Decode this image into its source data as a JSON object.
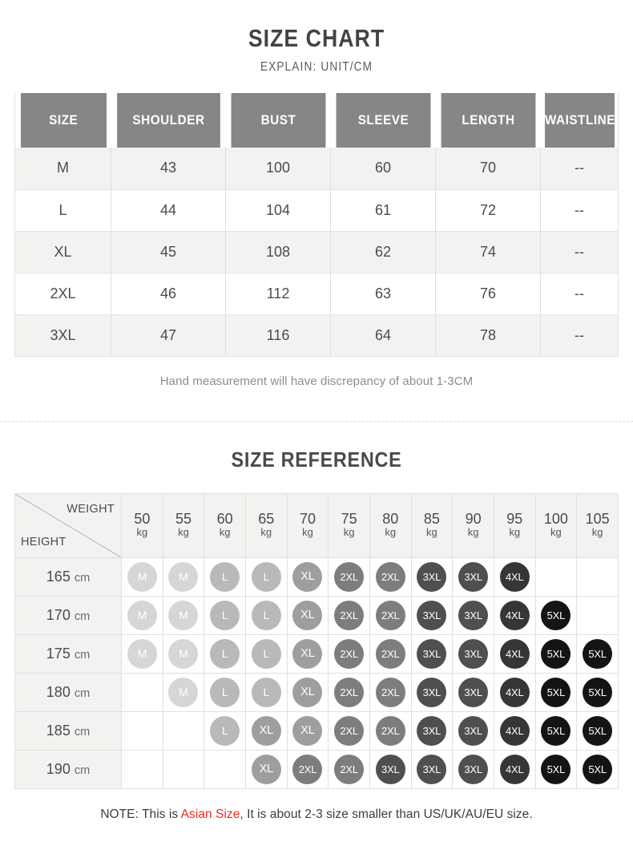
{
  "chart_data": {
    "type": "table",
    "title": "SIZE CHART",
    "subtitle": "EXPLAIN: UNIT/CM",
    "columns": [
      "SIZE",
      "SHOULDER",
      "BUST",
      "SLEEVE",
      "LENGTH",
      "WAISTLINE"
    ],
    "rows": [
      [
        "M",
        "43",
        "100",
        "60",
        "70",
        "--"
      ],
      [
        "L",
        "44",
        "104",
        "61",
        "72",
        "--"
      ],
      [
        "XL",
        "45",
        "108",
        "62",
        "74",
        "--"
      ],
      [
        "2XL",
        "46",
        "112",
        "63",
        "76",
        "--"
      ],
      [
        "3XL",
        "47",
        "116",
        "64",
        "78",
        "--"
      ]
    ],
    "footnote": "Hand measurement will have discrepancy of about 1-3CM"
  },
  "size_chart": {
    "title": "SIZE CHART",
    "subtitle": "EXPLAIN: UNIT/CM",
    "headers": [
      "SIZE",
      "SHOULDER",
      "BUST",
      "SLEEVE",
      "LENGTH",
      "WAISTLINE"
    ],
    "rows": [
      {
        "size": "M",
        "shoulder": "43",
        "bust": "100",
        "sleeve": "60",
        "length": "70",
        "waistline": "--"
      },
      {
        "size": "L",
        "shoulder": "44",
        "bust": "104",
        "sleeve": "61",
        "length": "72",
        "waistline": "--"
      },
      {
        "size": "XL",
        "shoulder": "45",
        "bust": "108",
        "sleeve": "62",
        "length": "74",
        "waistline": "--"
      },
      {
        "size": "2XL",
        "shoulder": "46",
        "bust": "112",
        "sleeve": "63",
        "length": "76",
        "waistline": "--"
      },
      {
        "size": "3XL",
        "shoulder": "47",
        "bust": "116",
        "sleeve": "64",
        "length": "78",
        "waistline": "--"
      }
    ],
    "hand_note": "Hand measurement will have discrepancy of about 1-3CM"
  },
  "size_reference": {
    "title": "SIZE REFERENCE",
    "weight_label": "WEIGHT",
    "height_label": "HEIGHT",
    "weight_unit": "kg",
    "height_unit": "cm",
    "weights": [
      "50",
      "55",
      "60",
      "65",
      "70",
      "75",
      "80",
      "85",
      "90",
      "95",
      "100",
      "105"
    ],
    "heights": [
      "165",
      "170",
      "175",
      "180",
      "185",
      "190"
    ],
    "matrix": [
      [
        "M",
        "M",
        "L",
        "L",
        "XL",
        "2XL",
        "2XL",
        "3XL",
        "3XL",
        "4XL",
        "",
        ""
      ],
      [
        "M",
        "M",
        "L",
        "L",
        "XL",
        "2XL",
        "2XL",
        "3XL",
        "3XL",
        "4XL",
        "5XL",
        ""
      ],
      [
        "M",
        "M",
        "L",
        "L",
        "XL",
        "2XL",
        "2XL",
        "3XL",
        "3XL",
        "4XL",
        "5XL",
        "5XL"
      ],
      [
        "",
        "M",
        "L",
        "L",
        "XL",
        "2XL",
        "2XL",
        "3XL",
        "3XL",
        "4XL",
        "5XL",
        "5XL"
      ],
      [
        "",
        "",
        "L",
        "XL",
        "XL",
        "2XL",
        "2XL",
        "3XL",
        "3XL",
        "4XL",
        "5XL",
        "5XL"
      ],
      [
        "",
        "",
        "",
        "XL",
        "2XL",
        "2XL",
        "3XL",
        "3XL",
        "3XL",
        "4XL",
        "5XL",
        "5XL"
      ]
    ]
  },
  "footer": {
    "prefix": "NOTE: This is ",
    "highlight": "Asian Size",
    "suffix": ", It is about 2-3 size smaller than US/UK/AU/EU size.",
    "highlight_color": "#ef2b24"
  },
  "colors": {
    "header_bg": "#868686",
    "row_alt_bg": "#f2f2f0",
    "text": "#4a4a4a",
    "bubble_M": "#d6d6d6",
    "bubble_L": "#b9b9b9",
    "bubble_XL": "#9e9e9e",
    "bubble_2XL": "#7d7d7d",
    "bubble_3XL": "#4f4f4f",
    "bubble_4XL": "#363636",
    "bubble_5XL": "#141414"
  }
}
